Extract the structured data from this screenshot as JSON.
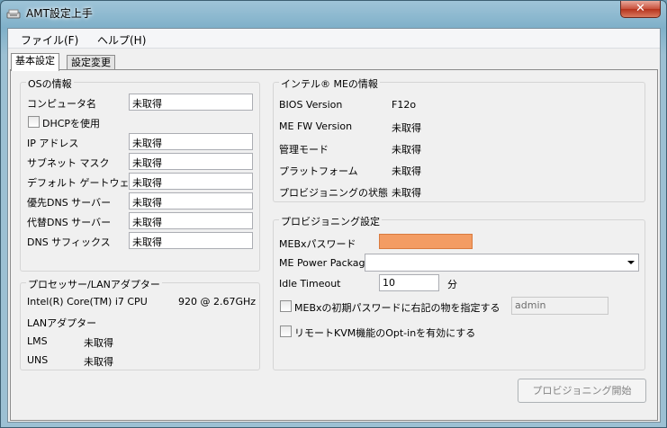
{
  "window": {
    "title": "AMT設定上手",
    "close": "✕"
  },
  "menu": {
    "file": "ファイル(F)",
    "help": "ヘルプ(H)"
  },
  "tabs": {
    "basic": "基本設定",
    "change": "設定変更"
  },
  "os": {
    "title": "OSの情報",
    "rows": [
      {
        "label": "コンピュータ名",
        "value": "未取得"
      },
      {
        "label": "IP アドレス",
        "value": "未取得"
      },
      {
        "label": "サブネット マスク",
        "value": "未取得"
      },
      {
        "label": "デフォルト ゲートウェイ",
        "value": "未取得"
      },
      {
        "label": "優先DNS サーバー",
        "value": "未取得"
      },
      {
        "label": "代替DNS サーバー",
        "value": "未取得"
      },
      {
        "label": "DNS サフィックス",
        "value": "未取得"
      }
    ],
    "dhcp_label": "DHCPを使用"
  },
  "processor": {
    "title": "プロセッサー/LANアダプター",
    "cpu": "Intel(R) Core(TM) i7 CPU",
    "cpu_model": "920  @ 2.67GHz",
    "lan_label": "LANアダプター",
    "lms_label": "LMS",
    "lms_value": "未取得",
    "uns_label": "UNS",
    "uns_value": "未取得"
  },
  "me": {
    "title": "インテル® MEの情報",
    "rows": [
      {
        "label": "BIOS Version",
        "value": "F12o"
      },
      {
        "label": "ME FW Version",
        "value": "未取得"
      },
      {
        "label": "管理モード",
        "value": "未取得"
      },
      {
        "label": "プラットフォーム",
        "value": "未取得"
      },
      {
        "label": "プロビジョニングの状態",
        "value": "未取得"
      }
    ]
  },
  "prov": {
    "title": "プロビジョニング設定",
    "mebx_pw_label": "MEBxパスワード",
    "me_pkg_label": "ME Power Package",
    "me_pkg_value": "",
    "idle_label": "Idle Timeout",
    "idle_value": "10",
    "idle_unit": "分",
    "init_pw_label": "MEBxの初期パスワードに右記の物を指定する",
    "init_pw_value": "admin",
    "kvm_label": "リモートKVM機能のOpt-inを有効にする",
    "start_button": "プロビジョニング開始"
  }
}
